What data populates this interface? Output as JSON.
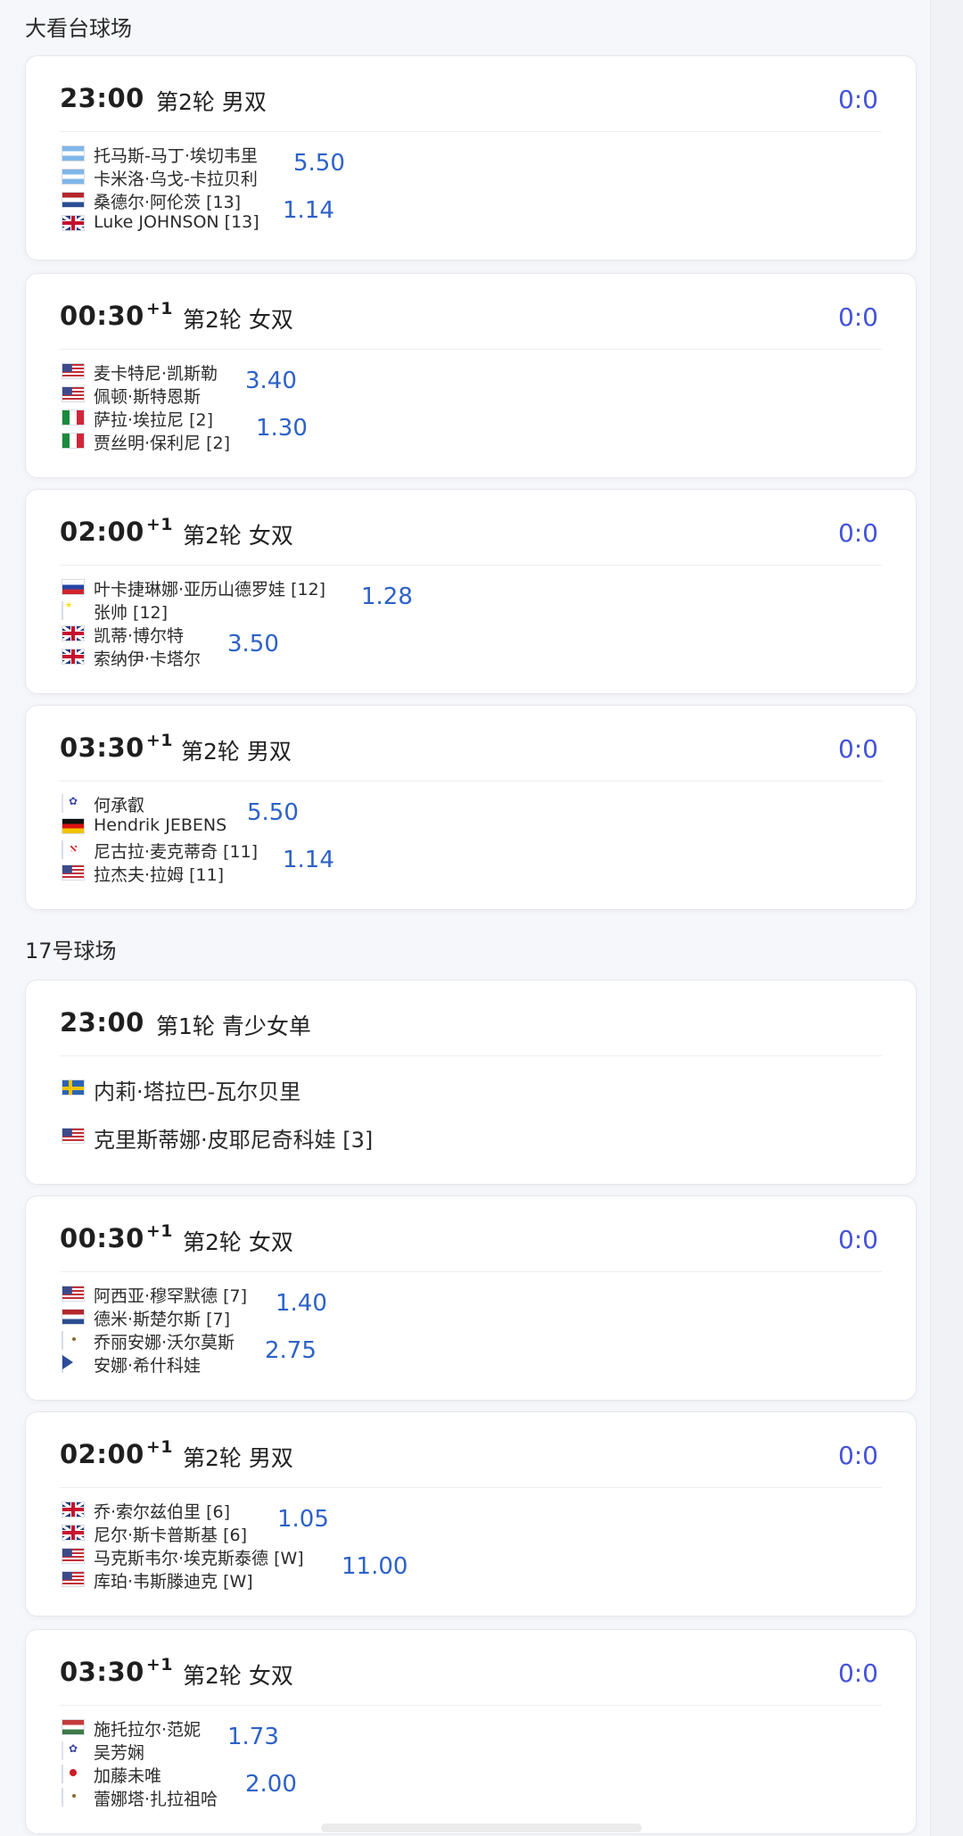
{
  "sections": [
    {
      "title": "大看台球场"
    },
    {
      "title": "17号球场"
    }
  ],
  "matches": [
    {
      "time": "23:00",
      "sup": "",
      "round": "第2轮 男双",
      "score": "0:0",
      "players": [
        {
          "flag": "ar",
          "name": "托马斯-马丁·埃切韦里"
        },
        {
          "flag": "ar",
          "name": "卡米洛·乌戈-卡拉贝利"
        },
        {
          "flag": "nl",
          "name": "桑德尔·阿伦茨 [13]"
        },
        {
          "flag": "gb",
          "name": "Luke JOHNSON [13]"
        }
      ],
      "odds": [
        "5.50",
        "1.14"
      ]
    },
    {
      "time": "00:30",
      "sup": "+1",
      "round": "第2轮 女双",
      "score": "0:0",
      "players": [
        {
          "flag": "us",
          "name": "麦卡特尼·凯斯勒"
        },
        {
          "flag": "us",
          "name": "佩顿·斯特恩斯"
        },
        {
          "flag": "it",
          "name": "萨拉·埃拉尼 [2]"
        },
        {
          "flag": "it",
          "name": "贾丝明·保利尼 [2]"
        }
      ],
      "odds": [
        "3.40",
        "1.30"
      ]
    },
    {
      "time": "02:00",
      "sup": "+1",
      "round": "第2轮 女双",
      "score": "0:0",
      "players": [
        {
          "flag": "ru",
          "name": "叶卡捷琳娜·亚历山德罗娃 [12]"
        },
        {
          "flag": "cn",
          "name": "张帅 [12]"
        },
        {
          "flag": "gb",
          "name": "凯蒂·博尔特"
        },
        {
          "flag": "gb",
          "name": "索纳伊·卡塔尔"
        }
      ],
      "odds": [
        "1.28",
        "3.50"
      ]
    },
    {
      "time": "03:30",
      "sup": "+1",
      "round": "第2轮 男双",
      "score": "0:0",
      "players": [
        {
          "flag": "tpe",
          "name": "何承叡"
        },
        {
          "flag": "de",
          "name": "Hendrik JEBENS"
        },
        {
          "flag": "hr",
          "name": "尼古拉·麦克蒂奇 [11]"
        },
        {
          "flag": "us",
          "name": "拉杰夫·拉姆 [11]"
        }
      ],
      "odds": [
        "5.50",
        "1.14"
      ]
    },
    {
      "time": "23:00",
      "sup": "",
      "round": "第1轮 青少女单",
      "score": "",
      "players": [
        {
          "flag": "se",
          "name": "内莉·塔拉巴-瓦尔贝里"
        },
        {
          "flag": "us",
          "name": "克里斯蒂娜·皮耶尼奇科娃 [3]"
        }
      ],
      "odds": []
    },
    {
      "time": "00:30",
      "sup": "+1",
      "round": "第2轮 女双",
      "score": "0:0",
      "players": [
        {
          "flag": "us",
          "name": "阿西亚·穆罕默德 [7]"
        },
        {
          "flag": "nl",
          "name": "德米·斯楚尔斯 [7]"
        },
        {
          "flag": "mx",
          "name": "乔丽安娜·沃尔莫斯"
        },
        {
          "flag": "cz",
          "name": "安娜·希什科娃"
        }
      ],
      "odds": [
        "1.40",
        "2.75"
      ]
    },
    {
      "time": "02:00",
      "sup": "+1",
      "round": "第2轮 男双",
      "score": "0:0",
      "players": [
        {
          "flag": "gb",
          "name": "乔·索尔兹伯里 [6]"
        },
        {
          "flag": "gb",
          "name": "尼尔·斯卡普斯基 [6]"
        },
        {
          "flag": "us",
          "name": "马克斯韦尔·埃克斯泰德 [W]"
        },
        {
          "flag": "us",
          "name": "库珀·韦斯滕迪克 [W]"
        }
      ],
      "odds": [
        "1.05",
        "11.00"
      ]
    },
    {
      "time": "03:30",
      "sup": "+1",
      "round": "第2轮 女双",
      "score": "0:0",
      "players": [
        {
          "flag": "hu",
          "name": "施托拉尔·范妮"
        },
        {
          "flag": "tpe",
          "name": "吴芳娴"
        },
        {
          "flag": "jp",
          "name": "加藤未唯"
        },
        {
          "flag": "mx",
          "name": "蕾娜塔·扎拉祖哈"
        }
      ],
      "odds": [
        "1.73",
        "2.00"
      ]
    }
  ]
}
